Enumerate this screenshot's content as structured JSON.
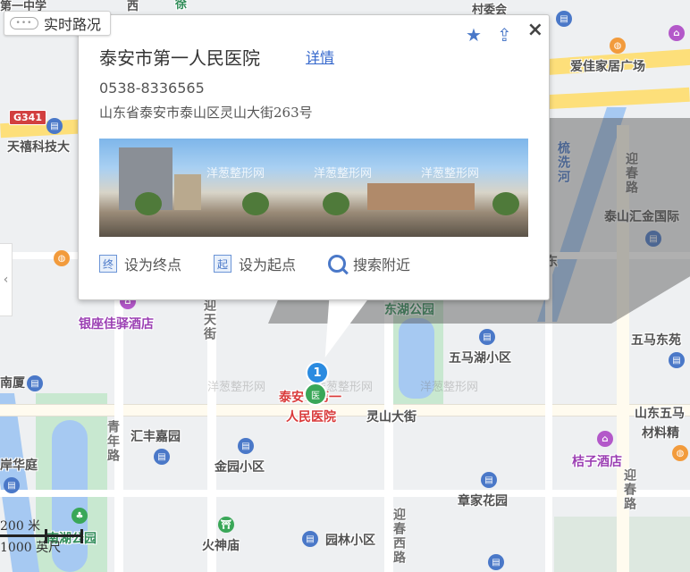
{
  "map": {
    "labels": {
      "top_partial_1": "第一中学",
      "top_partial_2": "西",
      "top_partial_3": "徐",
      "top_partial_4": "村委会",
      "aijia": "爱佳家居广场",
      "tianxi": "天禧科技大",
      "taishan_huijin": "泰山汇金国际",
      "yinzuo": "银座佳驿酒店",
      "donghu_park": "东湖公园",
      "wumahu": "五马湖小区",
      "wumadong": "五马东苑",
      "nanxia": "南厦",
      "huifeng": "汇丰嘉园",
      "jinyuan": "金园小区",
      "shandong_wuma": "山东五马",
      "cailiao": "材料精",
      "juzi_hotel": "桔子酒店",
      "zhangjia": "章家花园",
      "huoshen": "火神庙",
      "yuanlin": "园林小区",
      "nanhu_park": "南湖公园",
      "anhua": "岸华庭",
      "east_partial": "东",
      "hospital_line1": "泰安市第一",
      "hospital_line2": "人民医院",
      "lingshan": "灵山大街",
      "yingchun_top": "迎春路",
      "yingchun_bottom": "迎春路",
      "yingchun_west": "迎春西路",
      "qingnian": "青年路",
      "yingtian": "迎天街",
      "shuxi": "梳洗河",
      "watermark": "洋葱整形网"
    },
    "highway_badge": "G341"
  },
  "traffic": {
    "label": "实时路况",
    "icon": "traffic-toggle-icon"
  },
  "popup": {
    "title": "泰安市第一人民医院",
    "detail_link": "详情",
    "phone": "0538-8336565",
    "address": "山东省泰安市泰山区灵山大街263号",
    "photo_watermark": "洋葱整形网",
    "actions": {
      "set_end": "设为终点",
      "set_start": "设为起点",
      "search_nearby": "搜索附近"
    },
    "end_badge": "终",
    "start_badge": "起",
    "close": "×",
    "star": "★",
    "share": "⇪"
  },
  "marker": {
    "number": "1",
    "tag": "医"
  },
  "scale": {
    "metric": "200 米",
    "imperial": "1000 英尺"
  },
  "colors": {
    "accent": "#4a78c8",
    "link": "#3366cc",
    "marker_blue": "#2b8be0",
    "marker_green": "#3aa758",
    "water": "#a6c9f2",
    "park": "#c8e8d0"
  }
}
